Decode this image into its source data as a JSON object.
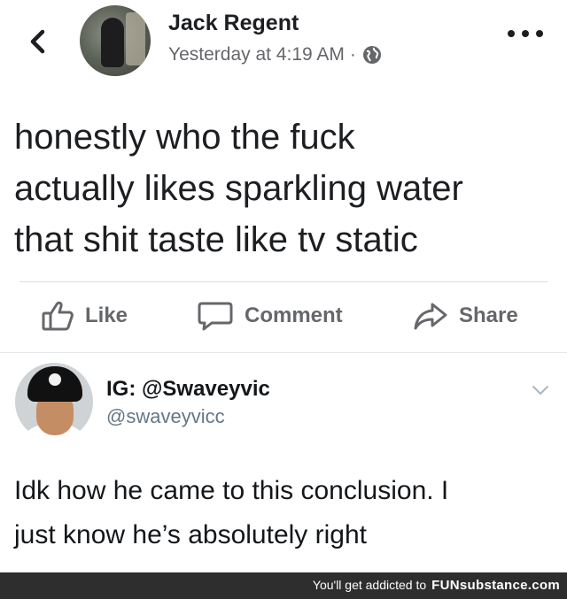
{
  "facebook_post": {
    "author": "Jack Regent",
    "timestamp": "Yesterday at 4:19 AM",
    "separator": "·",
    "privacy_icon": "globe-icon",
    "back_icon": "chevron-left-icon",
    "more_icon": "more-dots-icon",
    "lines": [
      "honestly who the fuck",
      "actually likes sparkling water",
      "that shit taste like tv static"
    ],
    "actions": {
      "like": "Like",
      "comment": "Comment",
      "share": "Share"
    }
  },
  "tweet": {
    "display_name": "IG: @Swaveyvic",
    "handle": "@swaveyvicc",
    "lines": [
      "Idk how he came to this conclusion. I",
      "just know he’s absolutely right"
    ]
  },
  "watermark": {
    "prefix": "You'll get addicted to",
    "brand": "FUNsubstance.com"
  },
  "colors": {
    "text": "#1c1e21",
    "secondary": "#65676b",
    "footer_bg": "#2e2e2e"
  }
}
